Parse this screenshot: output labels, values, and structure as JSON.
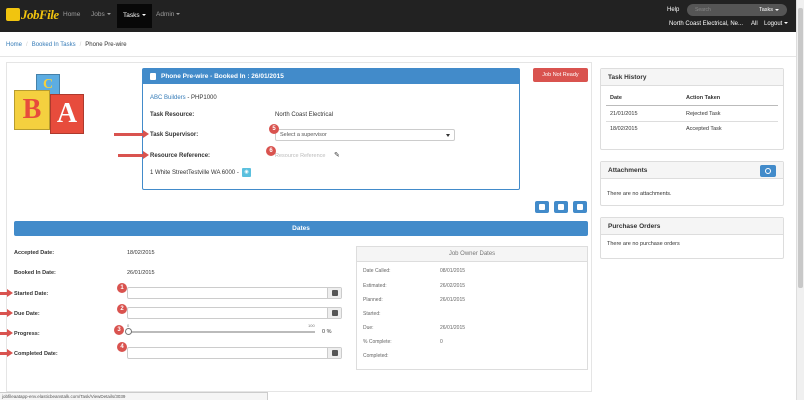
{
  "app": {
    "logo": "JobFile"
  },
  "nav": {
    "items": [
      {
        "label": "Home",
        "caret": false
      },
      {
        "label": "Jobs",
        "caret": true
      },
      {
        "label": "Tasks",
        "caret": true
      },
      {
        "label": "Admin",
        "caret": true
      }
    ],
    "active": "Tasks",
    "help": "Help",
    "search_placeholder": "Search",
    "search_scope": "Tasks",
    "company": "North Coast Electrical, Ne...",
    "all": "All",
    "logout": "Logout"
  },
  "breadcrumb": {
    "home": "Home",
    "booked": "Booked In Tasks",
    "current": "Phone Pre-wire"
  },
  "task": {
    "header": "Phone Pre-wire - Booked In : 26/01/2015",
    "builder": "ABC Builders",
    "job_code": "- PHP1000",
    "resource_label": "Task Resource:",
    "resource_value": "North Coast Electrical",
    "supervisor_label": "Task Supervisor:",
    "supervisor_placeholder": "Select a supervisor",
    "reference_label": "Resource Reference:",
    "reference_placeholder": "Resource Reference",
    "address": "1 White StreetTestville WA 6000 -",
    "status_button": "Job Not Ready"
  },
  "dates": {
    "title": "Dates",
    "accepted_label": "Accepted Date:",
    "accepted_value": "18/02/2015",
    "booked_label": "Booked In Date:",
    "booked_value": "26/01/2015",
    "started_label": "Started Date:",
    "due_label": "Due Date:",
    "progress_label": "Progress:",
    "progress_min": "0",
    "progress_max": "100",
    "progress_value": 0,
    "progress_text": "0 %",
    "completed_label": "Completed Date:"
  },
  "owner_dates": {
    "title": "Job Owner Dates",
    "rows": [
      {
        "label": "Date Called:",
        "value": "08/01/2015"
      },
      {
        "label": "Estimated:",
        "value": "26/02/2015"
      },
      {
        "label": "Planned:",
        "value": "26/01/2015"
      },
      {
        "label": "Started:",
        "value": ""
      },
      {
        "label": "Due:",
        "value": "26/01/2015"
      },
      {
        "label": "% Complete:",
        "value": "0"
      },
      {
        "label": "Completed:",
        "value": ""
      }
    ]
  },
  "history": {
    "title": "Task History",
    "col_date": "Date",
    "col_action": "Action Taken",
    "rows": [
      {
        "date": "21/01/2015",
        "action": "Rejected Task"
      },
      {
        "date": "18/02/2015",
        "action": "Accepted Task"
      }
    ]
  },
  "attachments": {
    "title": "Attachments",
    "empty": "There are no attachments."
  },
  "purchase_orders": {
    "title": "Purchase Orders",
    "empty": "There are no purchase orders"
  },
  "annotations": [
    "1",
    "2",
    "3",
    "4",
    "5",
    "6"
  ],
  "blocks": [
    "A",
    "B",
    "C"
  ],
  "status_url": "jobfileaatapp-env.elasticbeanstalk.com/Task/ViewDetails/3039",
  "colors": {
    "primary": "#428bca",
    "danger": "#d9534f",
    "navbar": "#222222",
    "logo": "#f1c40f"
  }
}
